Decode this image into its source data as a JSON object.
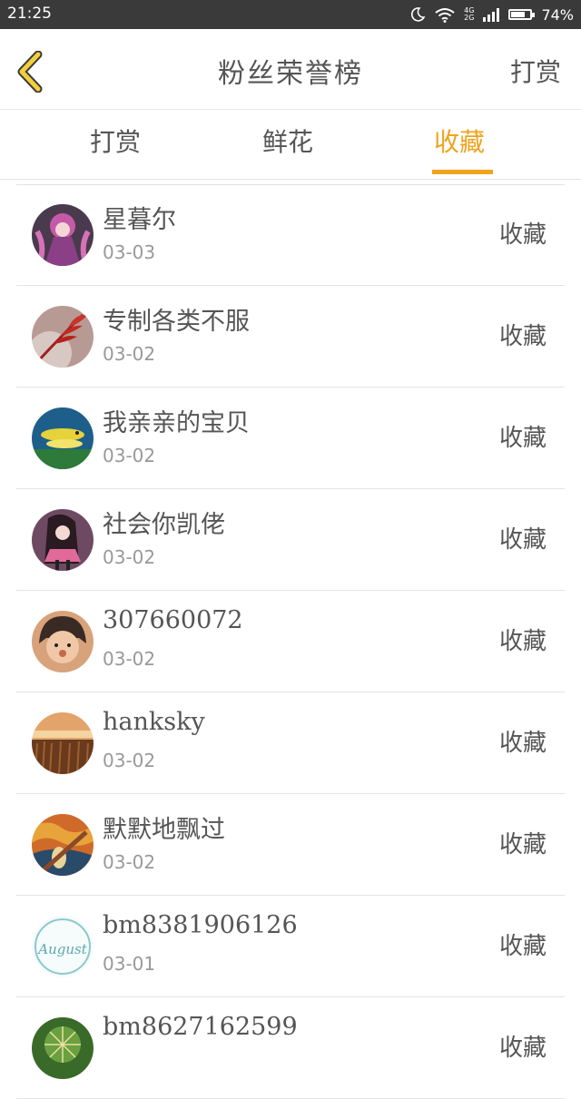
{
  "status": {
    "time": "21:25",
    "network_top": "4G",
    "network_bottom": "2G",
    "battery": "74%",
    "battery_level": 0.74
  },
  "header": {
    "title": "粉丝荣誉榜",
    "right_action": "打赏"
  },
  "tabs": [
    {
      "label": "打赏",
      "active": false
    },
    {
      "label": "鲜花",
      "active": false
    },
    {
      "label": "收藏",
      "active": true
    }
  ],
  "colors": {
    "accent": "#f0a31c",
    "status_bar": "#3a3a3a",
    "text": "#555555",
    "muted": "#999999"
  },
  "rows": [
    {
      "name": "星暮尔",
      "date": "03-03",
      "action": "收藏"
    },
    {
      "name": "专制各类不服",
      "date": "03-02",
      "action": "收藏"
    },
    {
      "name": "我亲亲的宝贝",
      "date": "03-02",
      "action": "收藏"
    },
    {
      "name": "社会你凯佬",
      "date": "03-02",
      "action": "收藏"
    },
    {
      "name": "307660072",
      "date": "03-02",
      "action": "收藏"
    },
    {
      "name": "hanksky",
      "date": "03-02",
      "action": "收藏"
    },
    {
      "name": "默默地飘过",
      "date": "03-02",
      "action": "收藏"
    },
    {
      "name": "bm8381906126",
      "date": "03-01",
      "action": "收藏"
    },
    {
      "name": "bm8627162599",
      "date": "",
      "action": "收藏"
    }
  ],
  "avatar_8_text": "August"
}
